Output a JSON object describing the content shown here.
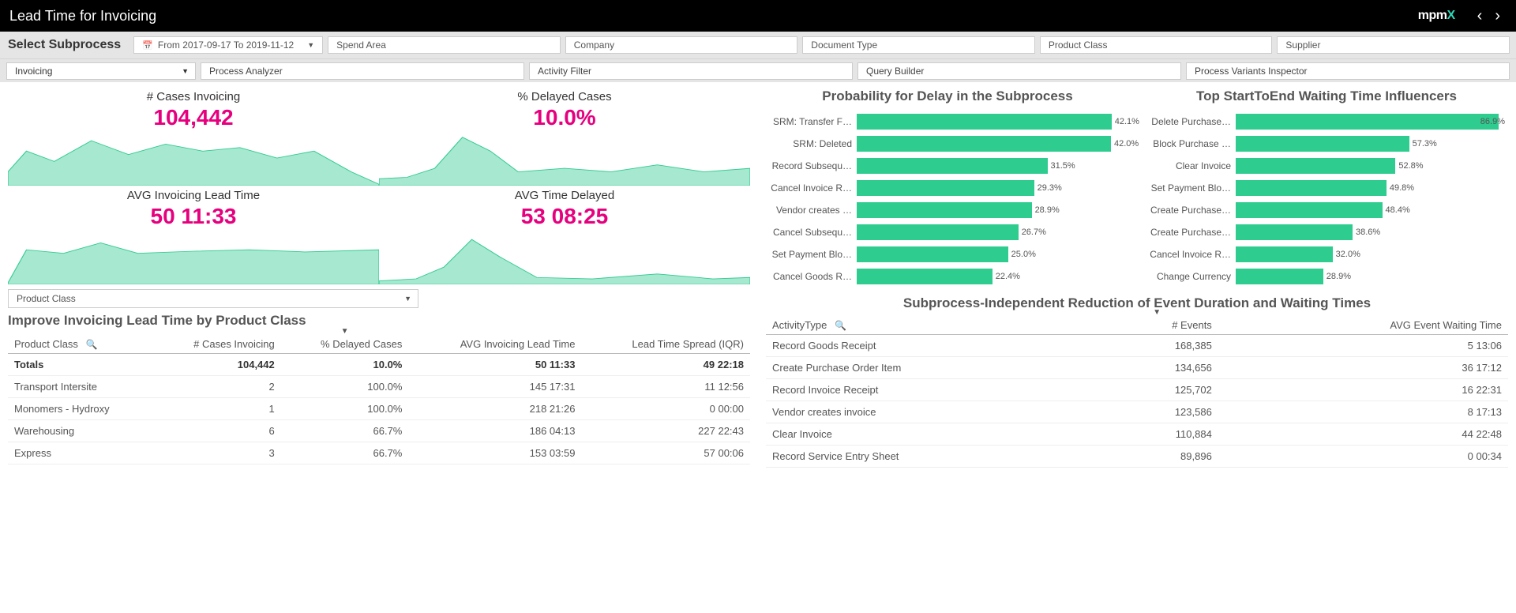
{
  "header": {
    "title": "Lead Time for Invoicing",
    "logo_text": "mpm",
    "logo_accent": "X"
  },
  "filters": {
    "select_label": "Select Subprocess",
    "date_range": "From 2017-09-17 To 2019-11-12",
    "spend_area": "Spend Area",
    "company": "Company",
    "document_type": "Document Type",
    "product_class": "Product Class",
    "supplier": "Supplier"
  },
  "subprocess_select": "Invoicing",
  "tabs": [
    "Process Analyzer",
    "Activity Filter",
    "Query Builder",
    "Process Variants Inspector"
  ],
  "kpis": [
    {
      "title": "# Cases Invoicing",
      "value": "104,442"
    },
    {
      "title": "% Delayed Cases",
      "value": "10.0%"
    },
    {
      "title": "AVG Invoicing Lead Time",
      "value": "50 11:33"
    },
    {
      "title": "AVG Time Delayed",
      "value": "53 08:25"
    }
  ],
  "class_select": "Product Class",
  "improve_title": "Improve Invoicing Lead Time by Product Class",
  "improve_table": {
    "columns": [
      "Product Class",
      "# Cases Invoicing",
      "% Delayed Cases",
      "AVG Invoicing Lead Time",
      "Lead Time Spread (IQR)"
    ],
    "totals": {
      "label": "Totals",
      "cases": "104,442",
      "delayed": "10.0%",
      "lead": "50 11:33",
      "spread": "49 22:18"
    },
    "rows": [
      {
        "label": "Transport Intersite",
        "cases": "2",
        "delayed": "100.0%",
        "lead": "145 17:31",
        "spread": "11 12:56"
      },
      {
        "label": "Monomers - Hydroxy",
        "cases": "1",
        "delayed": "100.0%",
        "lead": "218 21:26",
        "spread": "0 00:00"
      },
      {
        "label": "Warehousing",
        "cases": "6",
        "delayed": "66.7%",
        "lead": "186 04:13",
        "spread": "227 22:43"
      },
      {
        "label": "Express",
        "cases": "3",
        "delayed": "66.7%",
        "lead": "153 03:59",
        "spread": "57 00:06"
      }
    ]
  },
  "prob_title": "Probability for Delay in the Subprocess",
  "infl_title": "Top StartToEnd Waiting Time Influencers",
  "sub_title": "Subprocess-Independent Reduction of Event Duration and Waiting Times",
  "chart_data": [
    {
      "type": "bar",
      "title": "Probability for Delay in the Subprocess",
      "xlabel": "",
      "ylabel": "",
      "max": 45,
      "series": [
        {
          "name": "SRM: Transfer F…",
          "value": 42.1
        },
        {
          "name": "SRM: Deleted",
          "value": 42.0
        },
        {
          "name": "Record Subsequ…",
          "value": 31.5
        },
        {
          "name": "Cancel Invoice R…",
          "value": 29.3
        },
        {
          "name": "Vendor creates …",
          "value": 28.9
        },
        {
          "name": "Cancel Subsequ…",
          "value": 26.7
        },
        {
          "name": "Set Payment Blo…",
          "value": 25.0
        },
        {
          "name": "Cancel Goods R…",
          "value": 22.4
        }
      ]
    },
    {
      "type": "bar",
      "title": "Top StartToEnd Waiting Time Influencers",
      "xlabel": "",
      "ylabel": "",
      "max": 90,
      "series": [
        {
          "name": "Delete Purchase…",
          "value": 86.9,
          "inside": true
        },
        {
          "name": "Block Purchase …",
          "value": 57.3
        },
        {
          "name": "Clear Invoice",
          "value": 52.8
        },
        {
          "name": "Set Payment Blo…",
          "value": 49.8
        },
        {
          "name": "Create Purchase…",
          "value": 48.4
        },
        {
          "name": "Create Purchase…",
          "value": 38.6
        },
        {
          "name": "Cancel Invoice R…",
          "value": 32.0
        },
        {
          "name": "Change Currency",
          "value": 28.9
        }
      ]
    }
  ],
  "events_table": {
    "columns": [
      "ActivityType",
      "# Events",
      "AVG Event Waiting Time"
    ],
    "rows": [
      {
        "label": "Record Goods Receipt",
        "events": "168,385",
        "wait": "5 13:06"
      },
      {
        "label": "Create Purchase Order Item",
        "events": "134,656",
        "wait": "36 17:12"
      },
      {
        "label": "Record Invoice Receipt",
        "events": "125,702",
        "wait": "16 22:31"
      },
      {
        "label": "Vendor creates invoice",
        "events": "123,586",
        "wait": "8 17:13"
      },
      {
        "label": "Clear Invoice",
        "events": "110,884",
        "wait": "44 22:48"
      },
      {
        "label": "Record Service Entry Sheet",
        "events": "89,896",
        "wait": "0 00:34"
      }
    ]
  }
}
